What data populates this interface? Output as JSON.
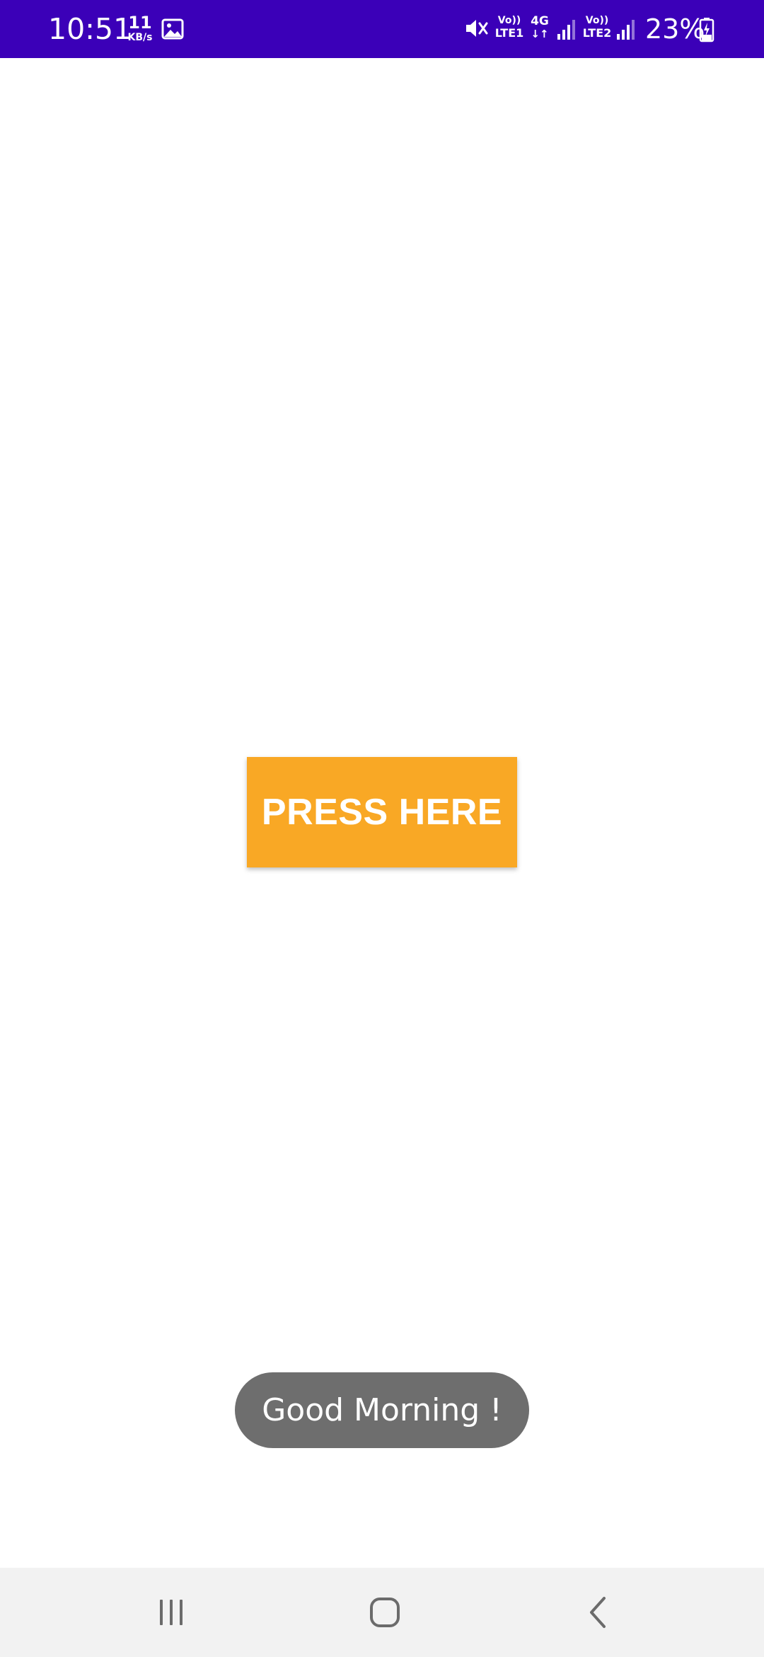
{
  "status_bar": {
    "time": "10:51",
    "net_speed_value": "11",
    "net_speed_unit": "KB/s",
    "sim1_label_top": "Vo))",
    "sim1_label_bottom": "LTE1",
    "network_type": "4G",
    "network_arrows": "↓↑",
    "sim2_label_top": "Vo))",
    "sim2_label_bottom": "LTE2",
    "battery_percent": "23%",
    "background_color": "#3b00b8",
    "icons": [
      "gallery-notification-icon",
      "mute-icon",
      "signal-icon",
      "battery-charging-icon"
    ]
  },
  "main": {
    "button_label": "PRESS HERE",
    "button_color": "#f9a825"
  },
  "toast": {
    "message": "Good Morning !",
    "background_color": "#6e6e6e"
  },
  "nav_bar": {
    "buttons": [
      "recents-icon",
      "home-icon",
      "back-icon"
    ]
  }
}
